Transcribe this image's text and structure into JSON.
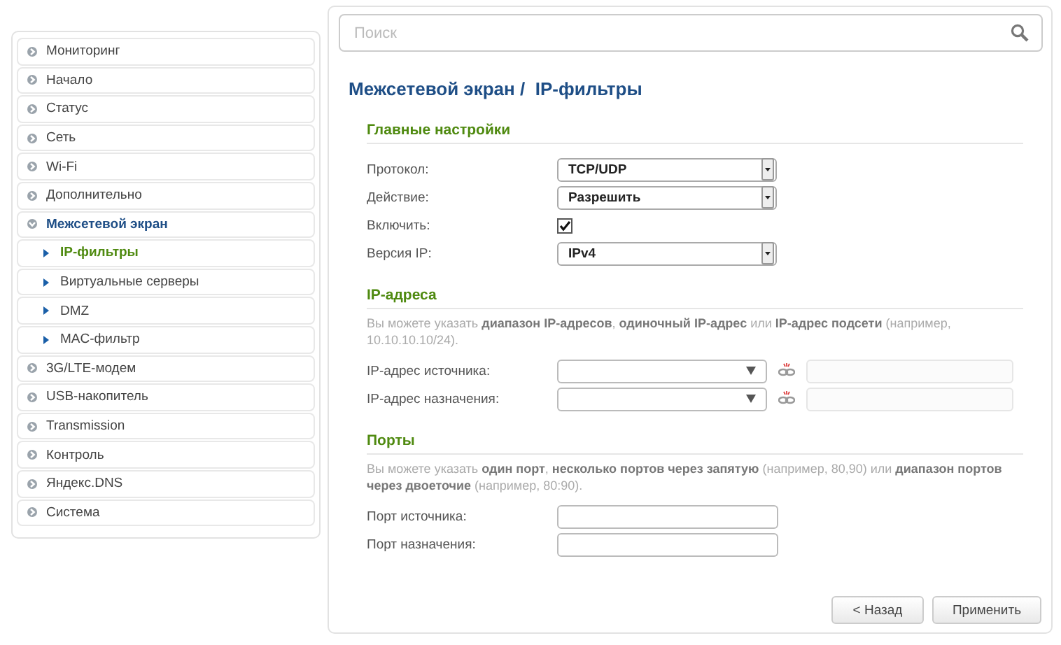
{
  "sidebar": {
    "items": [
      {
        "label": "Мониторинг",
        "selected": false,
        "expanded": false
      },
      {
        "label": "Начало",
        "selected": false,
        "expanded": false
      },
      {
        "label": "Статус",
        "selected": false,
        "expanded": false
      },
      {
        "label": "Сеть",
        "selected": false,
        "expanded": false
      },
      {
        "label": "Wi-Fi",
        "selected": false,
        "expanded": false
      },
      {
        "label": "Дополнительно",
        "selected": false,
        "expanded": false
      },
      {
        "label": "Межсетевой экран",
        "selected": false,
        "expanded": true,
        "children": [
          {
            "label": "IP-фильтры",
            "selected": true
          },
          {
            "label": "Виртуальные серверы",
            "selected": false
          },
          {
            "label": "DMZ",
            "selected": false
          },
          {
            "label": "MAC-фильтр",
            "selected": false
          }
        ]
      },
      {
        "label": "3G/LTE-модем",
        "selected": false,
        "expanded": false
      },
      {
        "label": "USB-накопитель",
        "selected": false,
        "expanded": false
      },
      {
        "label": "Transmission",
        "selected": false,
        "expanded": false
      },
      {
        "label": "Контроль",
        "selected": false,
        "expanded": false
      },
      {
        "label": "Яндекс.DNS",
        "selected": false,
        "expanded": false
      },
      {
        "label": "Система",
        "selected": false,
        "expanded": false
      }
    ]
  },
  "search": {
    "placeholder": "Поиск"
  },
  "page_title": "Межсетевой экран /  IP-фильтры",
  "sections": [
    {
      "title": "Главные настройки",
      "rows": [
        {
          "kind": "select",
          "label": "Протокол:",
          "value": "TCP/UDP"
        },
        {
          "kind": "select",
          "label": "Действие:",
          "value": "Разрешить"
        },
        {
          "kind": "checkbox",
          "label": "Включить:",
          "checked": true
        },
        {
          "kind": "select",
          "label": "Версия IP:",
          "value": "IPv4"
        }
      ]
    },
    {
      "title": "IP-адреса",
      "note": "Вы можете указать **диапазон IP-адресов**, **одиночный IP-адрес** или **IP-адрес подсети** (например, 10.10.10.10/24).",
      "rows": [
        {
          "kind": "combo",
          "label": "IP-адрес источника:"
        },
        {
          "kind": "combo",
          "label": "IP-адрес назначения:"
        }
      ]
    },
    {
      "title": "Порты",
      "note": "Вы можете указать **один порт**, **несколько портов через запятую** (например, 80,90) или **диапазон портов через двоеточие** (например, 80:90).",
      "rows": [
        {
          "kind": "text",
          "label": "Порт источника:"
        },
        {
          "kind": "text",
          "label": "Порт назначения:"
        }
      ]
    }
  ],
  "buttons": [
    "< Назад",
    "Применить"
  ]
}
